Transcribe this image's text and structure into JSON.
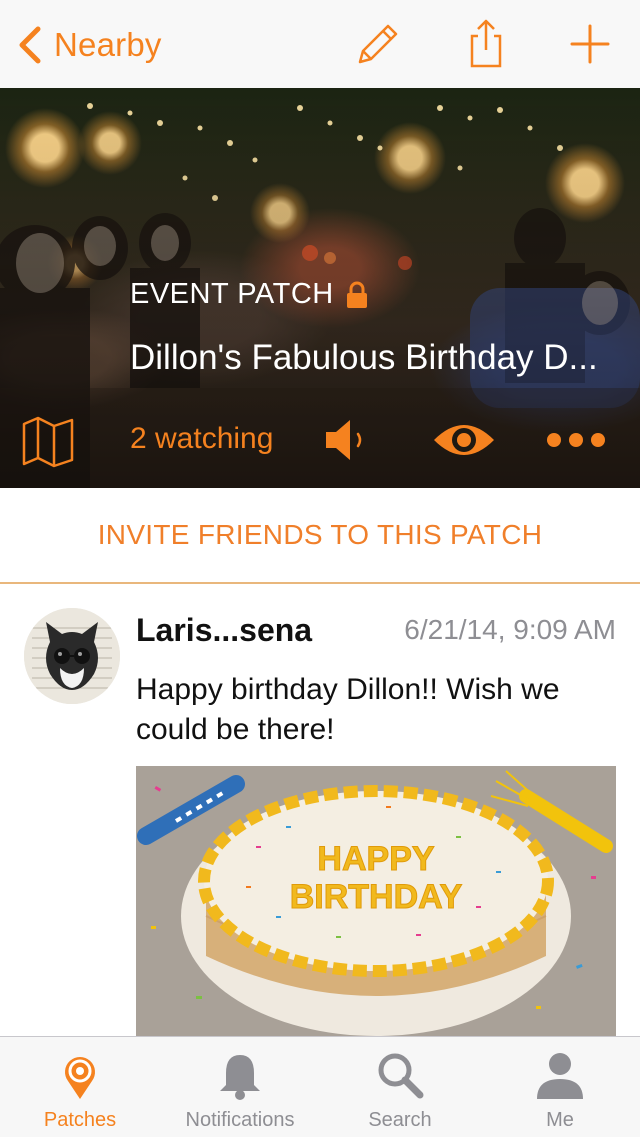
{
  "nav": {
    "back_label": "Nearby",
    "icons": [
      "pencil-icon",
      "share-icon",
      "plus-icon"
    ]
  },
  "hero": {
    "type_label": "EVENT PATCH",
    "title": "Dillon's Fabulous Birthday D...",
    "watching": "2 watching",
    "icons": [
      "map-icon",
      "speaker-icon",
      "eye-icon",
      "more-icon",
      "lock-icon"
    ]
  },
  "invite": {
    "label": "INVITE FRIENDS TO THIS PATCH"
  },
  "post": {
    "author": "Laris...sena",
    "timestamp": "6/21/14, 9:09 AM",
    "text": "Happy birthday Dillon!! Wish we could be there!",
    "photo_text": "HAPPY BIRTHDAY"
  },
  "tabs": [
    {
      "label": "Patches",
      "icon": "patches-icon",
      "active": true
    },
    {
      "label": "Notifications",
      "icon": "bell-icon",
      "active": false
    },
    {
      "label": "Search",
      "icon": "search-icon",
      "active": false
    },
    {
      "label": "Me",
      "icon": "person-icon",
      "active": false
    }
  ],
  "colors": {
    "accent": "#f5821f",
    "invite_text": "#f07f2a",
    "tab_inactive": "#8e8e93"
  }
}
